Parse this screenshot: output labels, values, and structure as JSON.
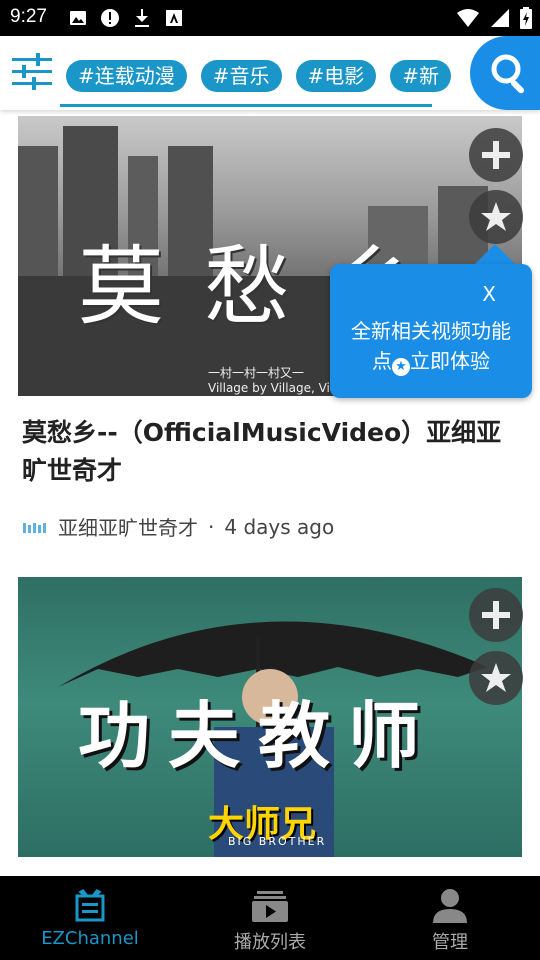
{
  "status_bar": {
    "time": "9:27"
  },
  "tags": [
    "#连载动漫",
    "#音乐",
    "#电影",
    "#新"
  ],
  "feed": [
    {
      "thumb_title_chars": [
        "莫",
        "愁",
        "乡"
      ],
      "thumb_subline": "一村一村一村又一",
      "thumb_subline2": "Village by Village, Village by Vi",
      "title": "莫愁乡--（OfficialMusicVideo）亚细亚旷世奇才",
      "channel": "亚细亚旷世奇才",
      "separator": "·",
      "age": "4 days ago"
    },
    {
      "thumb_title_chars": [
        "功",
        "夫",
        "教",
        "师"
      ],
      "thumb_sub": "大师兄",
      "thumb_sub_en": "BIG BROTHER"
    }
  ],
  "tooltip": {
    "close": "X",
    "line1": "全新相关视频功能",
    "line2_prefix": "点",
    "line2_suffix": "立即体验"
  },
  "bottom_nav": [
    {
      "label": "EZChannel",
      "icon": "tv-icon",
      "active": true
    },
    {
      "label": "播放列表",
      "icon": "playlist-icon",
      "active": false
    },
    {
      "label": "管理",
      "icon": "person-icon",
      "active": false
    }
  ],
  "colors": {
    "accent": "#1a96c8",
    "fab": "#1a8ee6",
    "navbar": "#000000"
  }
}
